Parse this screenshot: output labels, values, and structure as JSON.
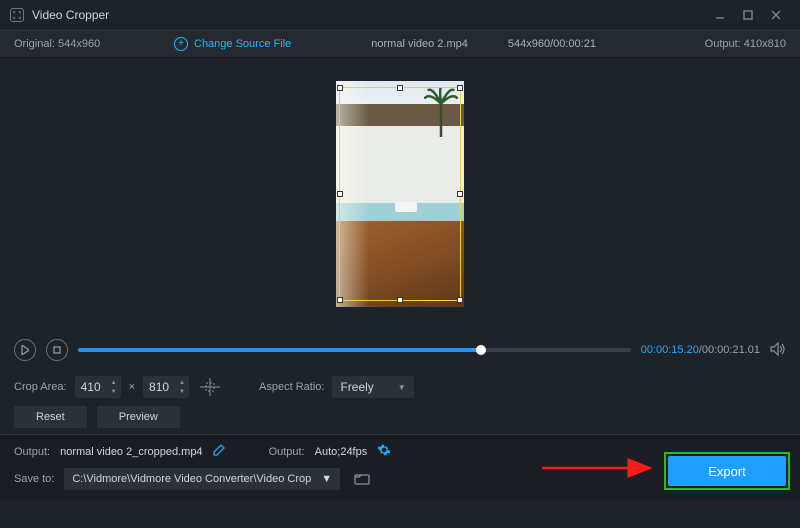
{
  "titlebar": {
    "title": "Video Cropper"
  },
  "infobar": {
    "original_label": "Original:",
    "original_value": "544x960",
    "change_source": "Change Source File",
    "filename": "normal video 2.mp4",
    "src_info": "544x960/00:00:21",
    "output_label": "Output:",
    "output_value": "410x810"
  },
  "player": {
    "current": "00:00:15.20",
    "total": "/00:00:21.01"
  },
  "crop": {
    "label": "Crop Area:",
    "w": "410",
    "h": "810",
    "x_sep": "×",
    "aspect_label": "Aspect Ratio:",
    "aspect_value": "Freely",
    "reset": "Reset",
    "preview": "Preview"
  },
  "bottom": {
    "out_label": "Output:",
    "out_name": "normal video 2_cropped.mp4",
    "fmt_label": "Output:",
    "fmt_value": "Auto;24fps",
    "save_label": "Save to:",
    "save_path": "C:\\Vidmore\\Vidmore Video Converter\\Video Crop",
    "export": "Export"
  }
}
